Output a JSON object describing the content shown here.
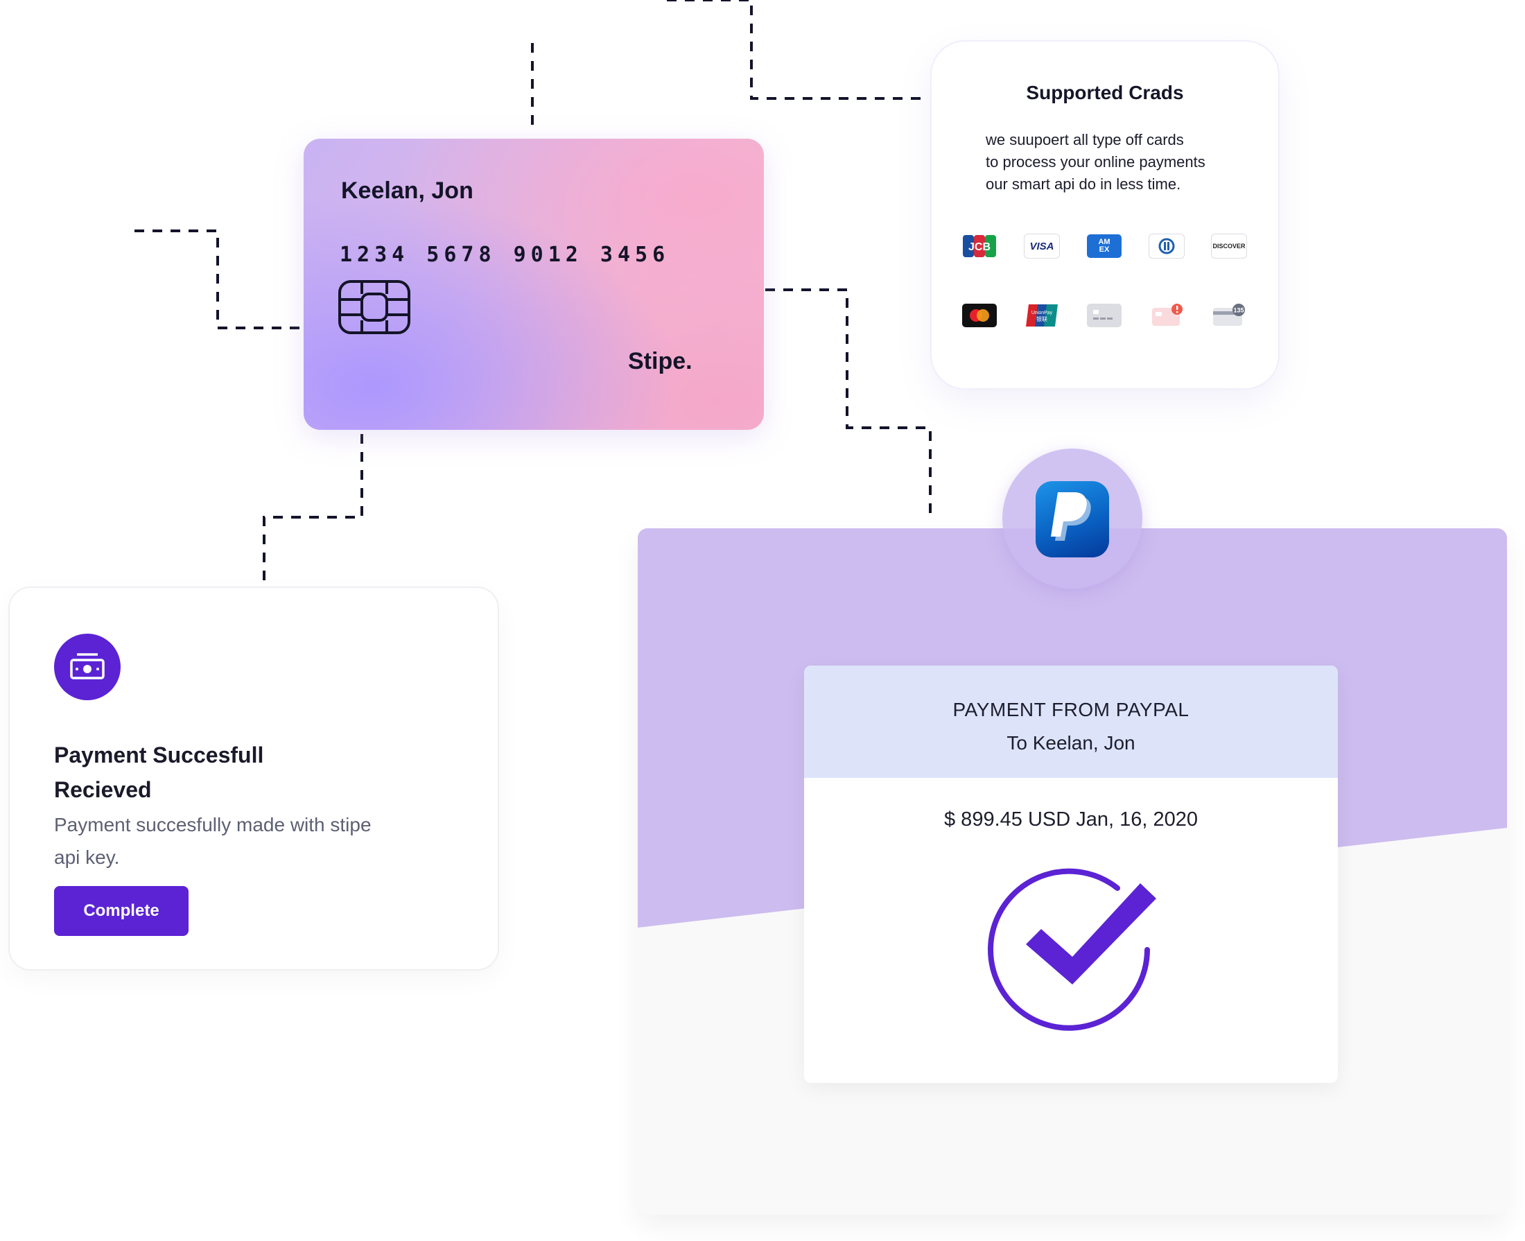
{
  "credit_card": {
    "holder": "Keelan, Jon",
    "number": "1234 5678 9012 3456",
    "brand": "Stipe.",
    "chip_icon": "card-chip-icon"
  },
  "supported_cards": {
    "title": "Supported Crads",
    "description_lines": [
      "we suupoert all type off cards",
      "to process your online payments",
      "our smart api do in less time."
    ],
    "logos": [
      {
        "name": "jcb",
        "text": "JCB"
      },
      {
        "name": "visa",
        "text": "VISA"
      },
      {
        "name": "amex",
        "text": "AM EX"
      },
      {
        "name": "diners-club",
        "text": ""
      },
      {
        "name": "discover",
        "text": "DISCOVER"
      },
      {
        "name": "mastercard",
        "text": ""
      },
      {
        "name": "unionpay",
        "text": "UnionPay 银联"
      },
      {
        "name": "generic-card",
        "text": ""
      },
      {
        "name": "card-error",
        "text": ""
      },
      {
        "name": "card-cvc",
        "text": "135"
      }
    ]
  },
  "payment_success": {
    "icon": "money-icon",
    "title_lines": [
      "Payment Succesfull",
      "Recieved"
    ],
    "description_lines": [
      "Payment succesfully made with stipe",
      "api key."
    ],
    "button_label": "Complete"
  },
  "paypal": {
    "icon": "paypal-icon",
    "receipt_title": "PAYMENT FROM PAYPAL",
    "recipient": "To Keelan, Jon",
    "amount_line": "$ 899.45 USD  Jan, 16, 2020",
    "status_icon": "check-circle-icon"
  },
  "colors": {
    "accent": "#5b23d4",
    "band": "#cdbcef",
    "receipt_header": "#dde4fa",
    "paypal_blue": "#0a63c4"
  }
}
